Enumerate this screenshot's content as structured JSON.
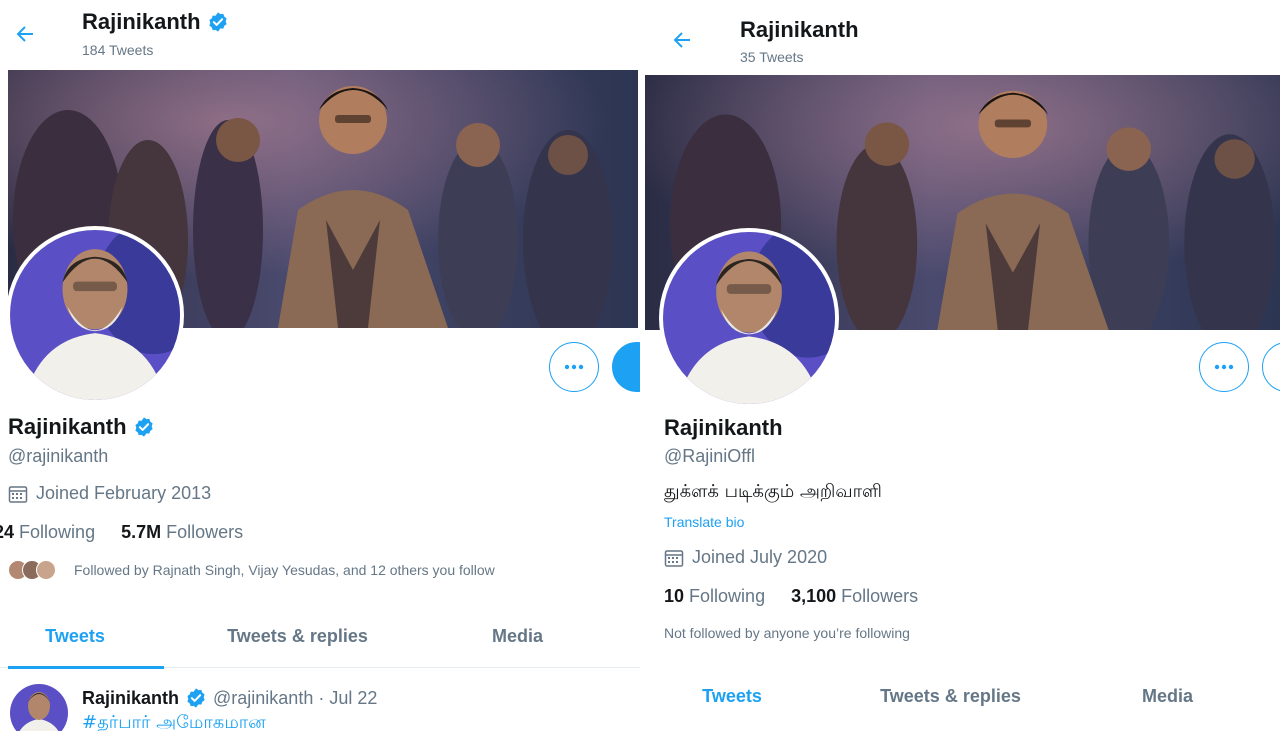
{
  "left": {
    "header": {
      "name": "Rajinikanth",
      "tweet_count": "184 Tweets"
    },
    "profile": {
      "name": "Rajinikanth",
      "handle": "@rajinikanth",
      "joined": "Joined February 2013",
      "following_count": "24",
      "following_label": "Following",
      "followers_count": "5.7M",
      "followers_label": "Followers",
      "followed_by": "Followed by Rajnath Singh, Vijay Yesudas, and 12 others you follow"
    },
    "tabs": [
      "Tweets",
      "Tweets & replies",
      "Media"
    ],
    "active_tab": "Tweets",
    "tweet": {
      "author": "Rajinikanth",
      "meta": "@rajinikanth · Jul 22",
      "text": "#தர்பார் அமோகமான"
    }
  },
  "right": {
    "header": {
      "name": "Rajinikanth",
      "tweet_count": "35 Tweets"
    },
    "profile": {
      "name": "Rajinikanth",
      "handle": "@RajiniOffl",
      "bio": "துக்ளக் படிக்கும் அறிவாளி",
      "translate_label": "Translate bio",
      "joined": "Joined July 2020",
      "following_count": "10",
      "following_label": "Following",
      "followers_count": "3,100",
      "followers_label": "Followers",
      "followed_by": "Not followed by anyone you’re following"
    },
    "tabs": [
      "Tweets",
      "Tweets & replies",
      "Media"
    ],
    "active_tab": "Tweets"
  },
  "colors": {
    "accent": "#1da1f2",
    "text": "#14171a",
    "muted": "#657786"
  },
  "icons": {
    "back": "arrow-left-icon",
    "verified": "verified-badge-icon",
    "more": "more-horizontal-icon",
    "calendar": "calendar-icon"
  }
}
